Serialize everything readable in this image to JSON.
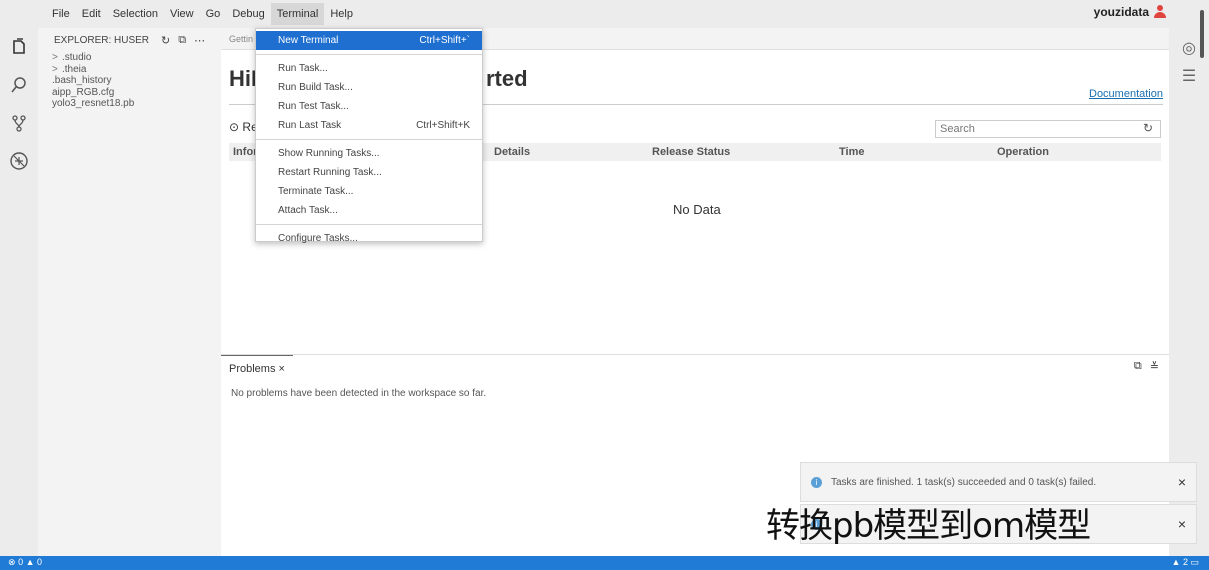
{
  "menubar": {
    "items": [
      "File",
      "Edit",
      "Selection",
      "View",
      "Go",
      "Debug",
      "Terminal",
      "Help"
    ],
    "user": "youzidata"
  },
  "explorer": {
    "title": "EXPLORER: HUSER",
    "items": [
      ".studio",
      ".theia",
      ".bash_history",
      "aipp_RGB.cfg",
      "yolo3_resnet18.pb"
    ]
  },
  "tab_title": "Gettin",
  "main": {
    "hero_left": "HiL",
    "hero_right": "rted",
    "doc_link": "Documentation",
    "section": "Re",
    "search_placeholder": "Search",
    "columns": [
      "Infor",
      "Details",
      "Release Status",
      "Time",
      "Operation"
    ],
    "empty": "No Data"
  },
  "terminal_menu": {
    "items": [
      {
        "label": "New Terminal",
        "shortcut": "Ctrl+Shift+`"
      },
      {
        "label": "Run Task..."
      },
      {
        "label": "Run Build Task..."
      },
      {
        "label": "Run Test Task..."
      },
      {
        "label": "Run Last Task",
        "shortcut": "Ctrl+Shift+K"
      },
      {
        "label": "Show Running Tasks..."
      },
      {
        "label": "Restart Running Task..."
      },
      {
        "label": "Terminate Task..."
      },
      {
        "label": "Attach Task..."
      },
      {
        "label": "Configure Tasks..."
      }
    ]
  },
  "panel": {
    "tab": "Problems",
    "message": "No problems have been detected in the workspace so far."
  },
  "notification": {
    "message": "Tasks are finished. 1 task(s) succeeded and 0 task(s) failed."
  },
  "overlay_caption": "转换pb模型到om模型",
  "statusbar": {
    "left": "0 ▲ 0",
    "right": "2"
  },
  "colors": {
    "accent": "#1f7bd6",
    "menu_selected": "#1f6fd0",
    "user_icon": "#e0443e"
  }
}
